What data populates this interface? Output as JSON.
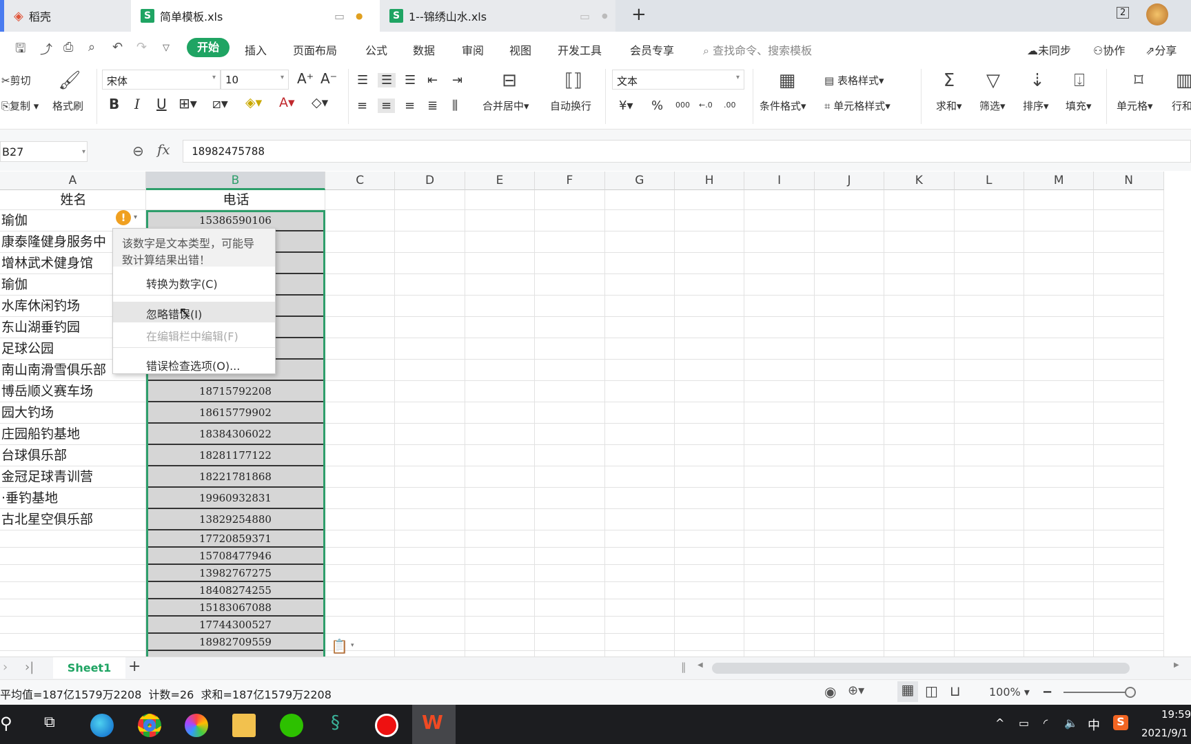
{
  "tabs": [
    {
      "label": "稻壳",
      "active": false
    },
    {
      "label": "简单模板.xls",
      "active": true
    },
    {
      "label": "1--锦绣山水.xls",
      "active": false
    }
  ],
  "tabbar": {
    "new_tab": "+",
    "window_count": "2"
  },
  "menu": {
    "items": [
      "开始",
      "插入",
      "页面布局",
      "公式",
      "数据",
      "审阅",
      "视图",
      "开发工具",
      "会员专享"
    ],
    "search": "查找命令、搜索模板",
    "sync": "未同步",
    "collab": "协作",
    "share": "分享"
  },
  "ribbon": {
    "cut": "剪切",
    "copy": "复制",
    "format_painter": "格式刷",
    "font": "宋体",
    "font_size": "10",
    "bold": "B",
    "italic": "I",
    "underline": "U",
    "merge": "合并居中",
    "wrap": "自动换行",
    "number_format": "文本",
    "currency": "¥",
    "percent": "%",
    "thousands": "000",
    "inc_dec": "←.0",
    "dec_dec": ".00",
    "cond_format": "条件格式",
    "table_style": "表格样式",
    "cell_style": "单元格样式",
    "sum": "求和",
    "filter": "筛选",
    "sort": "排序",
    "fill": "填充",
    "cells": "单元格",
    "rowcol": "行和"
  },
  "formula": {
    "cell_ref": "B27",
    "fx": "fx",
    "value": "18982475788"
  },
  "columns": [
    "A",
    "B",
    "C",
    "D",
    "E",
    "F",
    "G",
    "H",
    "I",
    "J",
    "K",
    "L",
    "M",
    "N"
  ],
  "header_row": {
    "a": "姓名",
    "b": "电话"
  },
  "rows": [
    {
      "name": "瑜伽",
      "phone": "15386590106"
    },
    {
      "name": "康泰隆健身服务中",
      "phone": ""
    },
    {
      "name": "增林武术健身馆",
      "phone": ""
    },
    {
      "name": "瑜伽",
      "phone": ""
    },
    {
      "name": "水库休闲钓场",
      "phone": ""
    },
    {
      "name": "东山湖垂钓园",
      "phone": ""
    },
    {
      "name": "足球公园",
      "phone": ""
    },
    {
      "name": "南山南滑雪俱乐部",
      "phone": ""
    },
    {
      "name": "博岳顺义赛车场",
      "phone": "18715792208"
    },
    {
      "name": "园大钓场",
      "phone": "18615779902"
    },
    {
      "name": "庄园船钓基地",
      "phone": "18384306022"
    },
    {
      "name": "台球俱乐部",
      "phone": "18281177122"
    },
    {
      "name": "金冠足球青训营",
      "phone": "18221781868"
    },
    {
      "name": "·垂钓基地",
      "phone": "19960932831"
    },
    {
      "name": "古北星空俱乐部",
      "phone": "13829254880"
    },
    {
      "name": "",
      "phone": "17720859371"
    },
    {
      "name": "",
      "phone": "15708477946"
    },
    {
      "name": "",
      "phone": "13982767275"
    },
    {
      "name": "",
      "phone": "18408274255"
    },
    {
      "name": "",
      "phone": "15183067088"
    },
    {
      "name": "",
      "phone": "17744300527"
    },
    {
      "name": "",
      "phone": "18982709559"
    },
    {
      "name": "",
      "phone": ""
    }
  ],
  "error_menu": {
    "message_line1": "该数字是文本类型，可能导",
    "message_line2": "致计算结果出错！",
    "convert": "转换为数字(C)",
    "ignore": "忽略错误(I)",
    "edit_in_bar": "在编辑栏中编辑(F)",
    "options": "错误检查选项(O)..."
  },
  "sheets": {
    "active": "Sheet1",
    "add": "+"
  },
  "status": {
    "summary": "平均值=187亿1579万2208  计数=26  求和=187亿1579万2208",
    "zoom": "100%"
  },
  "taskbar": {
    "time": "19:59",
    "date": "2021/9/1",
    "ime": "中"
  },
  "colors": {
    "accent": "#1fa463",
    "selection": "#2e9e6b",
    "warning": "#f0a020"
  }
}
